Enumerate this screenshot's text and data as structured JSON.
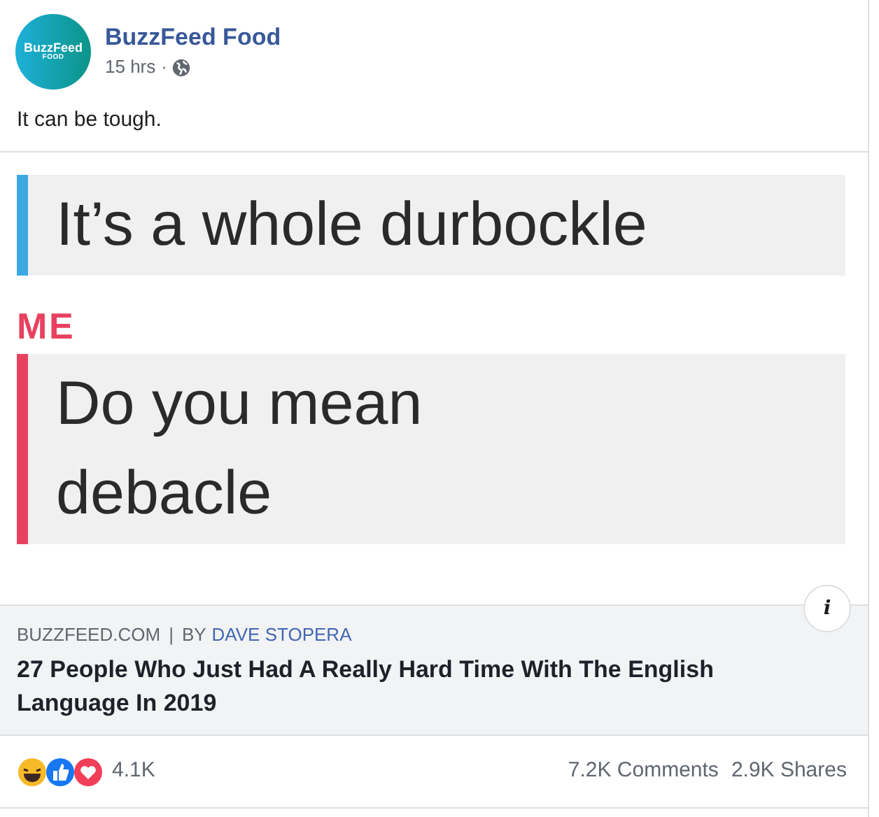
{
  "post": {
    "page_name": "BuzzFeed Food",
    "avatar": {
      "line_1": "BuzzFeed",
      "line_2": "FOOD"
    },
    "time": "15 hrs",
    "separator": "·",
    "text": "It can be tough."
  },
  "chat_image": {
    "messages": [
      {
        "color": "#3aa9e0",
        "lines": [
          "It’s a whole durbockle"
        ]
      },
      {
        "sender": "ME",
        "color": "#e8415f",
        "lines": [
          "Do you mean",
          "debacle"
        ]
      }
    ]
  },
  "link": {
    "domain": "BUZZFEED.COM",
    "divider": "|",
    "by": "BY",
    "author": "DAVE STOPERA",
    "title": "27 People Who Just Had A Really Hard Time With The English Language In 2019",
    "info": "i"
  },
  "footer": {
    "reactions": "4.1K",
    "comments": "7.2K Comments",
    "shares": "2.9K Shares"
  }
}
